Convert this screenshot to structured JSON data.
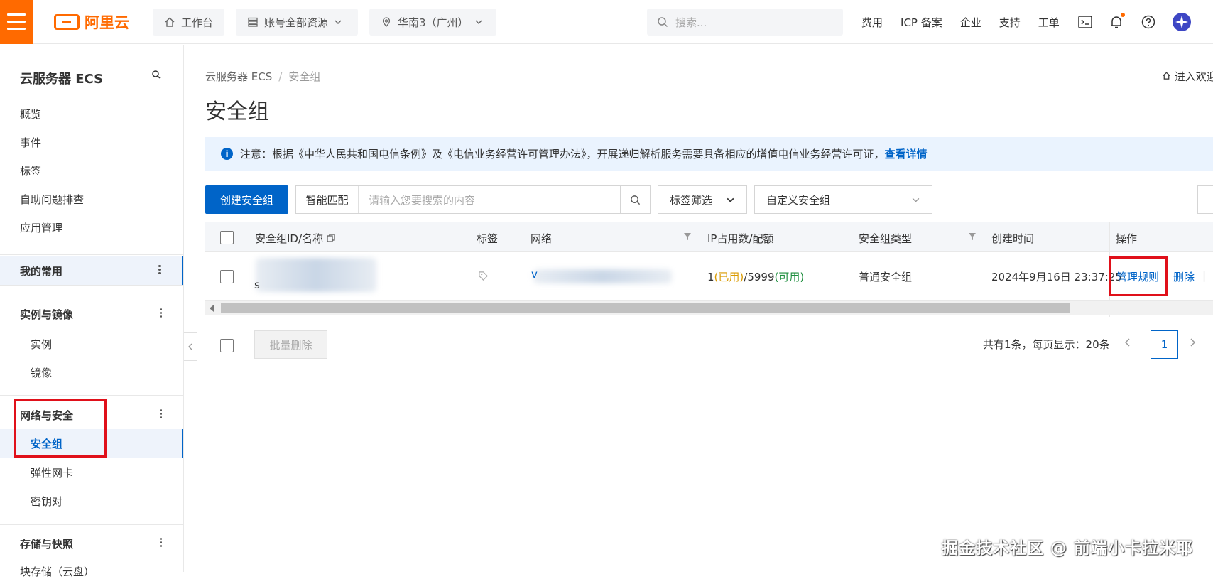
{
  "topbar": {
    "brand": "阿里云",
    "workbench": "工作台",
    "resources": "账号全部资源",
    "region": "华南3（广州）",
    "search_placeholder": "搜索...",
    "links": [
      "费用",
      "ICP 备案",
      "企业",
      "支持",
      "工单"
    ],
    "accent_color": "#ff6a00"
  },
  "sidebar": {
    "title": "云服务器 ECS",
    "top_items": [
      "概览",
      "事件",
      "标签",
      "自助问题排查",
      "应用管理"
    ],
    "favorites": "我的常用",
    "group_instances": "实例与镜像",
    "instances_items": [
      "实例",
      "镜像"
    ],
    "group_network": "网络与安全",
    "network_active": "安全组",
    "network_items": [
      "弹性网卡",
      "密钥对"
    ],
    "group_storage": "存储与快照",
    "storage_partial": "块存储（云盘）"
  },
  "main": {
    "breadcrumb": [
      "云服务器 ECS",
      "安全组"
    ],
    "breadcrumb_sep": "/",
    "welcome": "进入欢迎页",
    "title": "安全组",
    "notice_text": "注意：根据《中华人民共和国电信条例》及《电信业务经营许可管理办法》，开展递归解析服务需要具备相应的增值电信业务经营许可证，",
    "notice_link": "查看详情",
    "create_button": "创建安全组",
    "search_mode": "智能匹配",
    "search_placeholder": "请输入您要搜索的内容",
    "tag_filter": "标签筛选",
    "custom_group": "自定义安全组"
  },
  "table": {
    "headers": [
      "安全组ID/名称",
      "标签",
      "网络",
      "IP占用数/配额",
      "安全组类型",
      "创建时间",
      "操作"
    ],
    "row": {
      "id_prefix": "s",
      "network_prefix": "v",
      "ip_used_count": "1",
      "ip_used_label": "(已用)",
      "ip_sep": "/",
      "ip_quota": "5999",
      "ip_avail_label": "(可用)",
      "type": "普通安全组",
      "created": "2024年9月16日 23:37:25",
      "action_manage": "管理规则",
      "action_delete": "删除",
      "action_sep": "|"
    }
  },
  "footer": {
    "batch_delete": "批量删除",
    "pager_total": "共有1条，每页显示：20条",
    "page": "1"
  },
  "watermark": "掘金技术社区 @ 前端小卡拉米耶"
}
